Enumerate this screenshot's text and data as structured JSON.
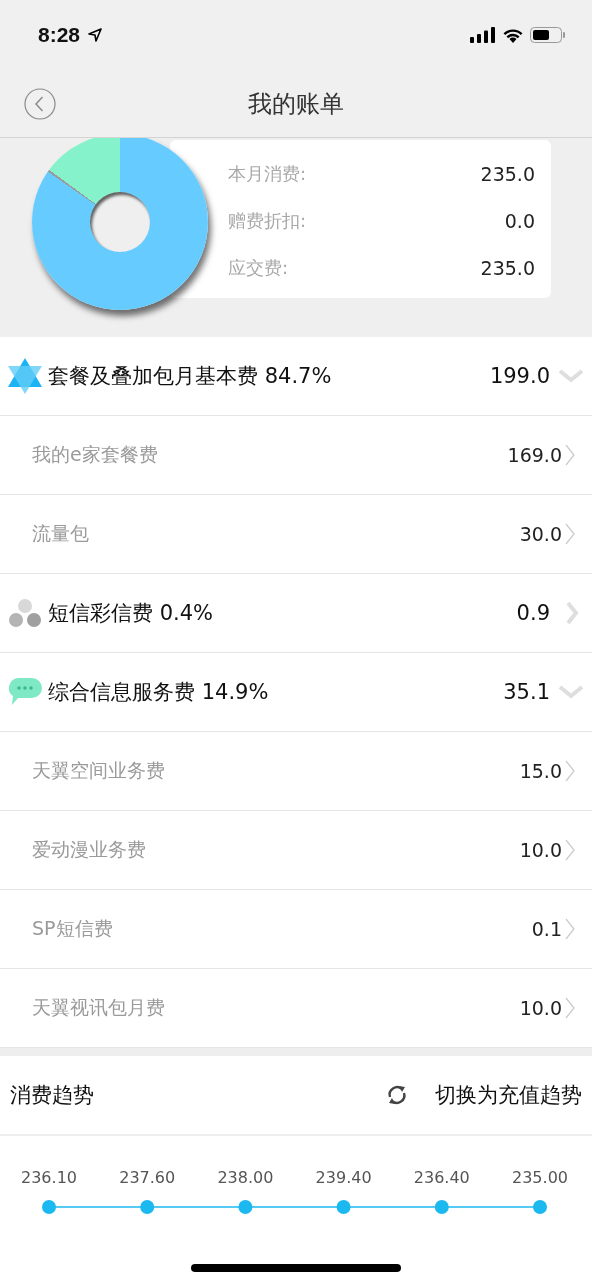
{
  "status_bar": {
    "time": "8:28"
  },
  "nav": {
    "title": "我的账单"
  },
  "summary": {
    "items": [
      {
        "label": "本月消费:",
        "value": "235.0"
      },
      {
        "label": "赠费折扣:",
        "value": "0.0"
      },
      {
        "label": "应交费:",
        "value": "235.0"
      }
    ]
  },
  "fees": [
    {
      "kind": "star",
      "label": "套餐及叠加包月基本费 84.7%",
      "amount": "199.0",
      "expanded": true,
      "children": [
        {
          "label": "我的e家套餐费",
          "amount": "169.0"
        },
        {
          "label": "流量包",
          "amount": "30.0"
        }
      ]
    },
    {
      "kind": "dots",
      "label": "短信彩信费 0.4%",
      "amount": "0.9",
      "expanded": false
    },
    {
      "kind": "bubble",
      "label": "综合信息服务费 14.9%",
      "amount": "35.1",
      "expanded": true,
      "children": [
        {
          "label": "天翼空间业务费",
          "amount": "15.0"
        },
        {
          "label": "爱动漫业务费",
          "amount": "10.0"
        },
        {
          "label": "SP短信费",
          "amount": "0.1"
        },
        {
          "label": "天翼视讯包月费",
          "amount": "10.0"
        }
      ]
    }
  ],
  "trend": {
    "title": "消费趋势",
    "switch_label": "切换为充值趋势",
    "points": [
      {
        "label": "236.10"
      },
      {
        "label": "237.60"
      },
      {
        "label": "238.00"
      },
      {
        "label": "239.40"
      },
      {
        "label": "236.40"
      },
      {
        "label": "235.00"
      }
    ]
  }
}
